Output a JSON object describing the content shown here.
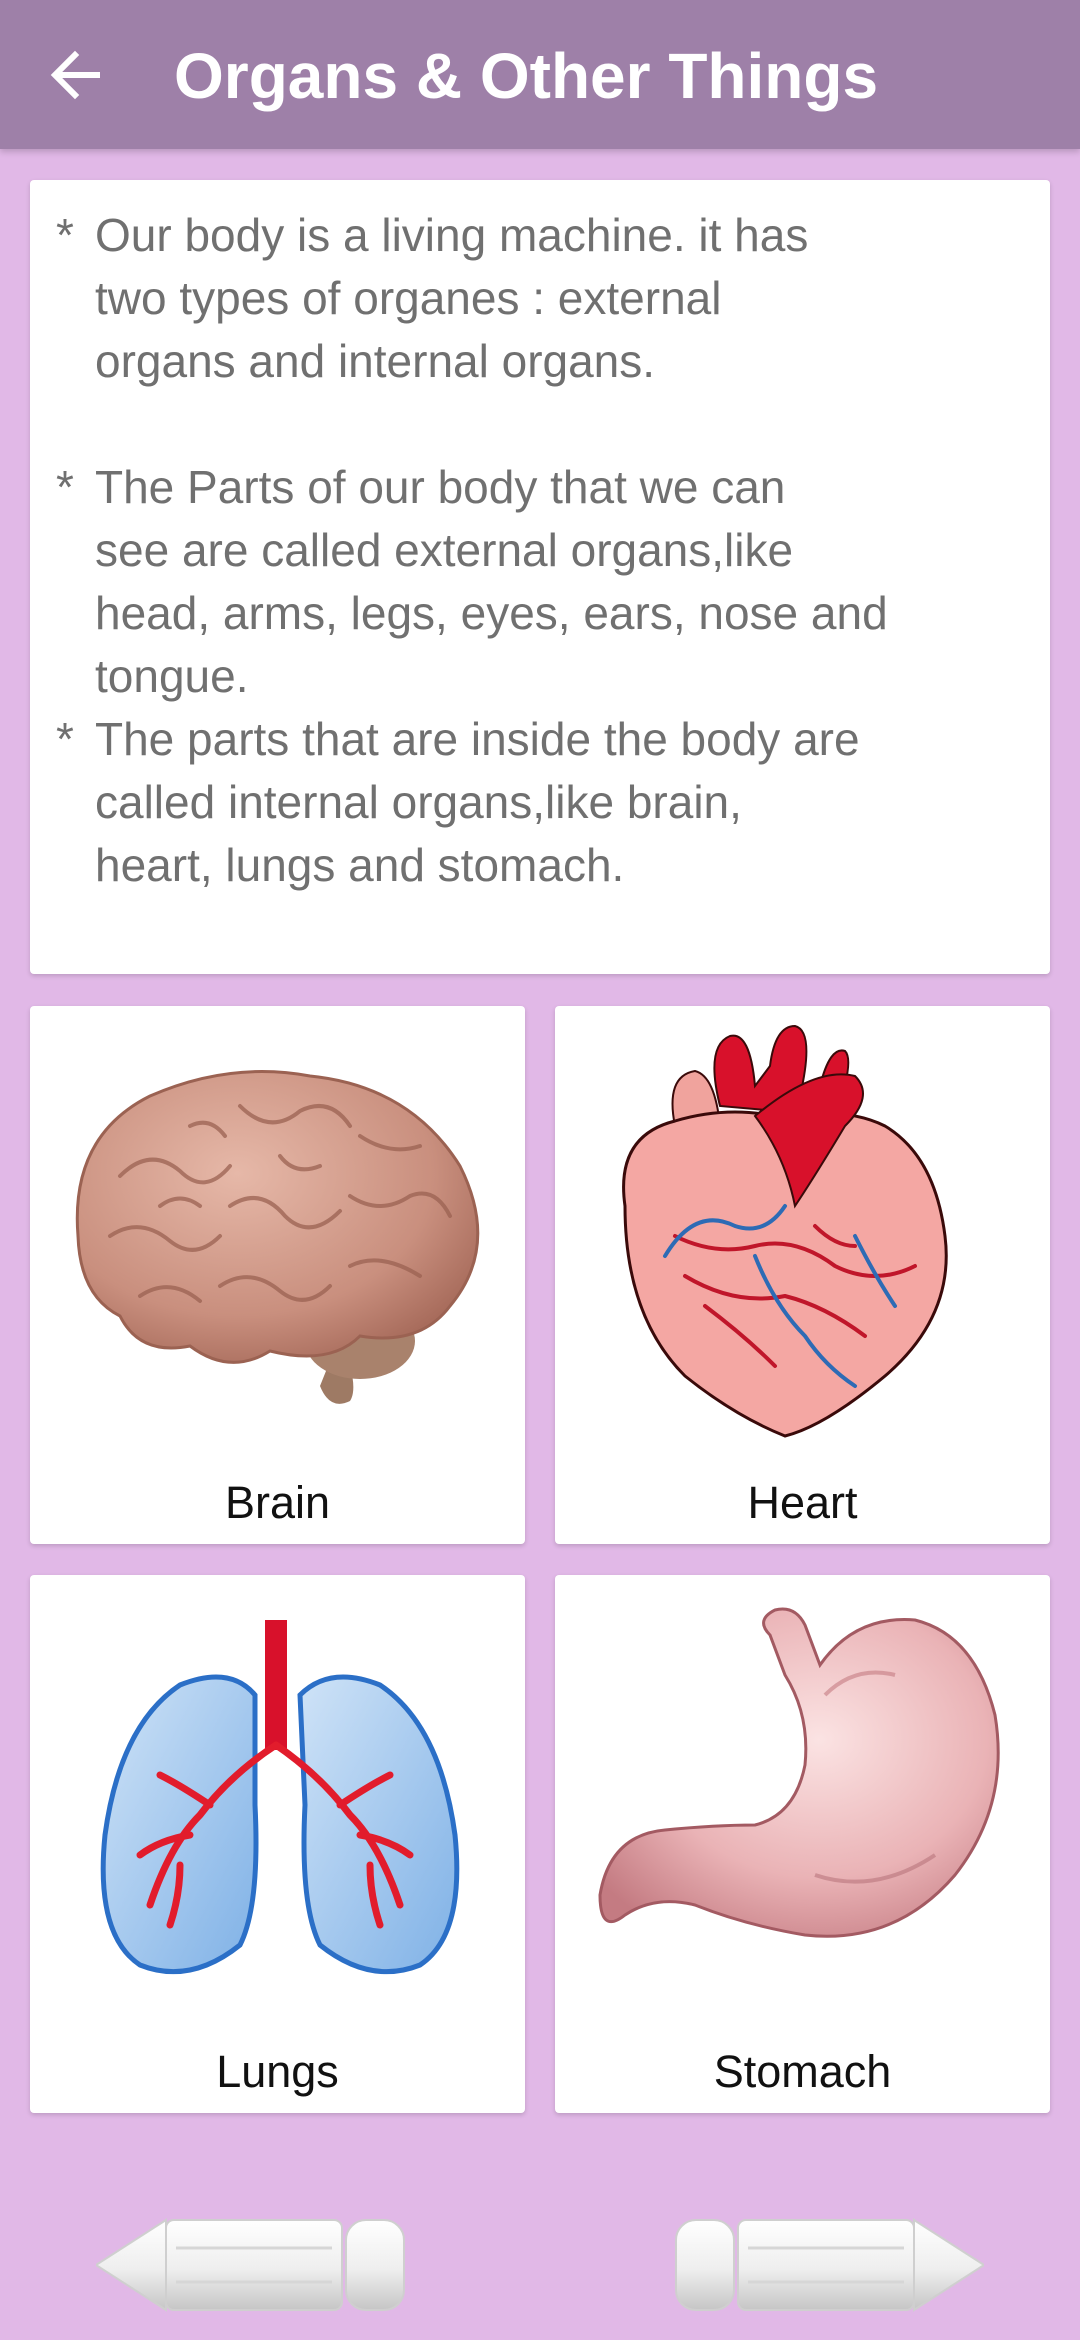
{
  "header": {
    "title": "Organs & Other Things",
    "back_icon": "arrow-left-icon"
  },
  "info": {
    "bullet": "*",
    "paragraphs": [
      {
        "lines": [
          "Our body is a living machine. it has",
          "two types of organes : external",
          "organs and internal organs."
        ]
      },
      {
        "lines": [
          "The Parts of our body that we can",
          "see are called external organs,like",
          "head, arms, legs, eyes, ears, nose and",
          "tongue."
        ]
      },
      {
        "lines": [
          "The parts that are inside the body are",
          "called internal organs,like brain,",
          "heart, lungs and stomach."
        ]
      }
    ]
  },
  "organs": [
    {
      "label": "Brain",
      "icon": "brain-image"
    },
    {
      "label": "Heart",
      "icon": "heart-image"
    },
    {
      "label": "Lungs",
      "icon": "lungs-image"
    },
    {
      "label": "Stomach",
      "icon": "stomach-image"
    }
  ],
  "navigation": {
    "previous_icon": "previous-arrow-icon",
    "next_icon": "next-arrow-icon"
  },
  "colors": {
    "background": "#e1b8e7",
    "app_bar": "#9e80a8",
    "card": "#ffffff",
    "body_text": "#707070"
  }
}
